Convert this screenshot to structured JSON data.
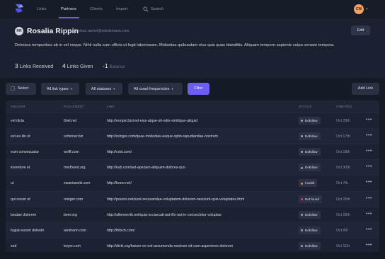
{
  "colors": {
    "accent": "#6c5ef2",
    "dofollow": "#9aa1b3",
    "invalid": "#e8862c",
    "not_found": "#e2405a"
  },
  "nav": {
    "logo_icon": "cube-logo-icon",
    "items": [
      {
        "label": "Links",
        "active": false
      },
      {
        "label": "Partners",
        "active": true
      },
      {
        "label": "Clients",
        "active": false
      },
      {
        "label": "Import",
        "active": false
      }
    ],
    "search_label": "Search",
    "user_initials": "CW"
  },
  "profile": {
    "initials": "RR",
    "name": "Rosalia Rippin",
    "email": "stokes.rachel@stiedemann.com",
    "edit_label": "Edit",
    "bio": "Delectus temporibus ab in vel neque. Nihil nulla eum officia ut fugit laboriosam. Molestias quibusdam eius quis quas blanditiis. Aliquam tempore sapiente culpa veniam tempora.",
    "stats": {
      "received_value": "3",
      "received_label": "Links Received",
      "given_value": "4",
      "given_label": "Links Given",
      "balance_value": "-1",
      "balance_label": "Balance"
    }
  },
  "filters": {
    "select_label": "Select",
    "link_types_label": "All link types",
    "statuses_label": "All statuses",
    "crawl_label": "All crawl frequencies",
    "filter_label": "Filter",
    "add_link_label": "Add Link"
  },
  "table": {
    "columns": [
      "ANCHOR",
      "PLACEMENT",
      "LINK",
      "STATUS",
      "CREATED"
    ],
    "rows": [
      {
        "anchor": "vel dicta",
        "placement": "thiel.net",
        "link": "http://rempel.biz/vel-eius-atque-sit-odio-similique-aliquid",
        "status": "Dofollow",
        "status_type": "dofollow",
        "created": "Oct 29th"
      },
      {
        "anchor": "est ea illo et",
        "placement": "schinner.biz",
        "link": "http://reinger.com/quae-molestias-eaque-optio-repudiandae-nostrum",
        "status": "Dofollow",
        "status_type": "dofollow",
        "created": "Oct 17th"
      },
      {
        "anchor": "eum consequatur",
        "placement": "wolff.com",
        "link": "http://crist.com/",
        "status": "Dofollow",
        "status_type": "dofollow",
        "created": "Oct 18th"
      },
      {
        "anchor": "inventore et",
        "placement": "medhurst.org",
        "link": "http://kub.com/aut-aperiam-aliquam-dolores-quo",
        "status": "Dofollow",
        "status_type": "dofollow",
        "created": "Oct 30th"
      },
      {
        "anchor": "ut",
        "placement": "swaniawski.com",
        "link": "http://borer.net/",
        "status": "Invalid",
        "status_type": "invalid",
        "created": "Oct 7th"
      },
      {
        "anchor": "qui rerum ut",
        "placement": "reinger.com",
        "link": "http://pouros.net/sunt-recusandae-voluptatem-dolorem-nesciunt-quis-voluptates.html",
        "status": "Not found",
        "status_type": "not_found",
        "created": "Oct 25th"
      },
      {
        "anchor": "beatae dolorem",
        "placement": "beer.org",
        "link": "http://altenwerth.net/quia-occaecati-aut-illo-aut-in-consectetur-voluptas",
        "status": "Dofollow",
        "status_type": "dofollow",
        "created": "Oct 28th"
      },
      {
        "anchor": "fugiat earum deleniti",
        "placement": "weimann.com",
        "link": "http://fritsch.com/",
        "status": "Dofollow",
        "status_type": "dofollow",
        "created": "Oct 9th"
      },
      {
        "anchor": "sed",
        "placement": "boyer.com",
        "link": "http://dicki.org/harum-ex-est-assumenda-nostrum-sit-cum-asperiores-dolorem",
        "status": "Dofollow",
        "status_type": "dofollow",
        "created": "Oct 11th"
      }
    ]
  }
}
